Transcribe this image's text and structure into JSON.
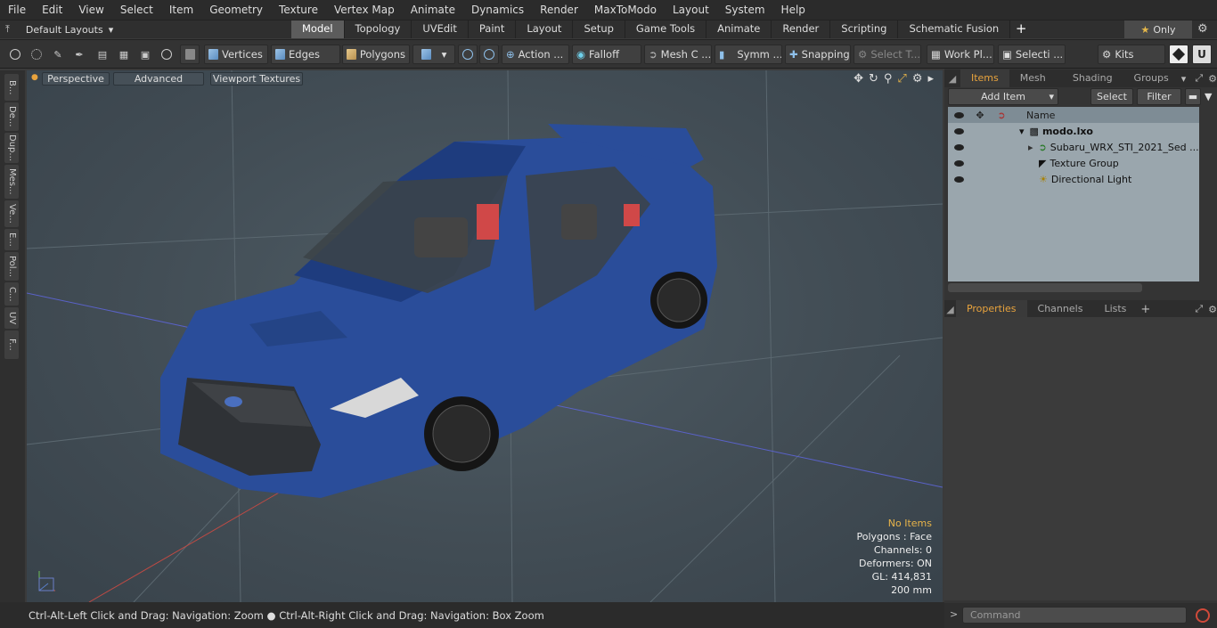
{
  "menu": [
    "File",
    "Edit",
    "View",
    "Select",
    "Item",
    "Geometry",
    "Texture",
    "Vertex Map",
    "Animate",
    "Dynamics",
    "Render",
    "MaxToModo",
    "Layout",
    "System",
    "Help"
  ],
  "layout_selector": "Default Layouts",
  "tabs": [
    "Model",
    "Topology",
    "UVEdit",
    "Paint",
    "Layout",
    "Setup",
    "Game Tools",
    "Animate",
    "Render",
    "Scripting",
    "Schematic Fusion"
  ],
  "active_tab": "Model",
  "only_label": "Only",
  "toolbar": {
    "vertices": "Vertices",
    "edges": "Edges",
    "polygons": "Polygons",
    "action": "Action ...",
    "falloff": "Falloff",
    "mesh": "Mesh C ...",
    "symm": "Symm ...",
    "snapping": "Snapping",
    "select_t": "Select T...",
    "work_pl": "Work Pl...",
    "selecti": "Selecti ...",
    "kits": "Kits"
  },
  "viewport": {
    "perspective": "Perspective",
    "advanced": "Advanced",
    "textures": "Viewport Textures",
    "info": {
      "no_items": "No Items",
      "polygons": "Polygons : Face",
      "channels": "Channels: 0",
      "deformers": "Deformers: ON",
      "gl": "GL: 414,831",
      "scale": "200 mm"
    }
  },
  "side_tabs": [
    "B...",
    "De...",
    "Dup...",
    "Mes...",
    "Ve...",
    "E...",
    "Pol...",
    "C...",
    "UV",
    "F..."
  ],
  "status": "Ctrl-Alt-Left Click and Drag: Navigation: Zoom ● Ctrl-Alt-Right Click and Drag: Navigation: Box Zoom",
  "items_panel": {
    "tabs": [
      "Items",
      "Mesh ...",
      "Shading",
      "Groups"
    ],
    "add_item": "Add Item",
    "select": "Select",
    "filter": "Filter",
    "col_name": "Name",
    "rows": [
      "modo.lxo",
      "Subaru_WRX_STI_2021_Sed ...",
      "Texture Group",
      "Directional Light"
    ]
  },
  "props_panel": {
    "tabs": [
      "Properties",
      "Channels",
      "Lists"
    ]
  },
  "command_placeholder": "Command"
}
